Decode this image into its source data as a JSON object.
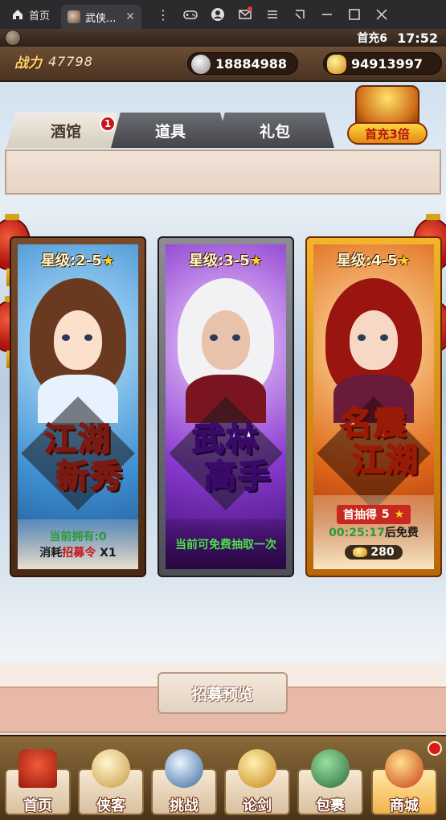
{
  "emulator": {
    "home_tab_label": "首页",
    "game_tab_label": "武侠...",
    "close_tab": "✕"
  },
  "status": {
    "first_charge_short": "首充6",
    "clock": "17:52"
  },
  "resources": {
    "power_label": "战力",
    "power_value": "47798",
    "silver": "18884988",
    "gold": "94913997"
  },
  "promo": {
    "label": "首充3倍"
  },
  "tabs": [
    {
      "label": "酒馆",
      "badge": "1"
    },
    {
      "label": "道具"
    },
    {
      "label": "礼包"
    }
  ],
  "cards": [
    {
      "star_range": "星级:2-5",
      "title_l1": "江湖",
      "title_l2": "新秀",
      "owned": "当前拥有:0",
      "cost_prefix": "消耗",
      "cost_item": "招募令",
      "cost_suffix": " X1"
    },
    {
      "star_range": "星级:3-5",
      "title_l1": "武林",
      "title_l2": "高手",
      "free_text": "当前可免费抽取一次"
    },
    {
      "star_range": "星级:4-5",
      "title_l1": "名震",
      "title_l2": "江湖",
      "first_draw": "首抽得",
      "first_draw_value": "5",
      "timer": "00:25:17",
      "timer_suffix": "后免费",
      "price": "280"
    }
  ],
  "preview_button": "招募预览",
  "nav": [
    {
      "label": "首页"
    },
    {
      "label": "侠客"
    },
    {
      "label": "挑战"
    },
    {
      "label": "论剑"
    },
    {
      "label": "包裹"
    },
    {
      "label": "商城"
    }
  ],
  "colors": {
    "accent_red": "#c8161d",
    "gold": "#ffd21e",
    "green": "#2a9a3a"
  }
}
